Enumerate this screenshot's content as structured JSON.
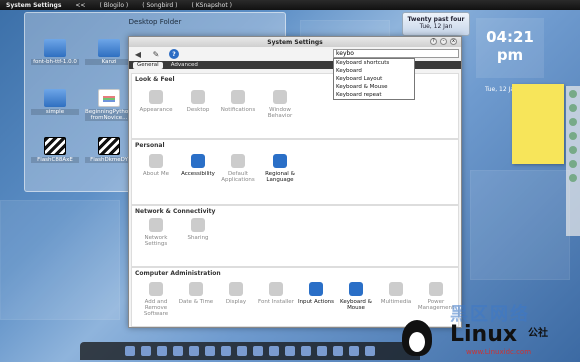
{
  "top_panel": {
    "app_title": "System Settings",
    "menu_marker": "<<",
    "tasks": [
      "( Blogilo )",
      "( Songbird )",
      "( KSnapshot )"
    ]
  },
  "desktop_folder": {
    "title": "Desktop Folder",
    "items": [
      {
        "label": "font-bh-ttf-1.0.0",
        "icon": "folder-icon"
      },
      {
        "label": "Kanzi",
        "icon": "folder-icon"
      },
      {
        "label": "simple",
        "icon": "folder-icon"
      },
      {
        "label": "BeginningPython-fromNovice...",
        "icon": "document-icon"
      },
      {
        "label": "FlashC88AxE",
        "icon": "clapperboard-icon"
      },
      {
        "label": "FlashDkmeDY",
        "icon": "clapperboard-icon"
      }
    ]
  },
  "clock_widget": {
    "title": "Twenty past four",
    "date": "Tue, 12 Jan"
  },
  "big_clock": {
    "time": "04:21 pm",
    "date": "Tue, 12 Jan 2010"
  },
  "window": {
    "title": "System Settings",
    "controls": [
      "?",
      "-",
      "x"
    ],
    "search_value": "keybo",
    "suggestions": [
      "Keyboard shortcuts",
      "Keyboard",
      "Keyboard Layout",
      "Keyboard & Mouse",
      "Keyboard repeat"
    ],
    "tabs": [
      "General",
      "Advanced"
    ],
    "sections": [
      {
        "title": "Look & Feel",
        "items": [
          {
            "label": "Appearance",
            "icon": "appearance-icon",
            "active": false
          },
          {
            "label": "Desktop",
            "icon": "desktop-icon",
            "active": false
          },
          {
            "label": "Notifications",
            "icon": "notifications-icon",
            "active": false
          },
          {
            "label": "Window Behavior",
            "icon": "window-behavior-icon",
            "active": false
          }
        ]
      },
      {
        "title": "Personal",
        "items": [
          {
            "label": "About Me",
            "icon": "about-me-icon",
            "active": false
          },
          {
            "label": "Accessibility",
            "icon": "accessibility-icon",
            "active": true
          },
          {
            "label": "Default Applications",
            "icon": "default-applications-icon",
            "active": false
          },
          {
            "label": "Regional & Language",
            "icon": "regional-language-icon",
            "active": true
          }
        ]
      },
      {
        "title": "Network & Connectivity",
        "items": [
          {
            "label": "Network Settings",
            "icon": "network-settings-icon",
            "active": false
          },
          {
            "label": "Sharing",
            "icon": "sharing-icon",
            "active": false
          }
        ]
      },
      {
        "title": "Computer Administration",
        "items": [
          {
            "label": "Add and Remove Software",
            "icon": "add-remove-software-icon",
            "active": false
          },
          {
            "label": "Date & Time",
            "icon": "date-time-icon",
            "active": false
          },
          {
            "label": "Display",
            "icon": "display-icon",
            "active": false
          },
          {
            "label": "Font Installer",
            "icon": "font-installer-icon",
            "active": false
          },
          {
            "label": "Input Actions",
            "icon": "input-actions-icon",
            "active": true
          },
          {
            "label": "Keyboard & Mouse",
            "icon": "keyboard-mouse-icon",
            "active": true
          },
          {
            "label": "Multimedia",
            "icon": "multimedia-icon",
            "active": false
          },
          {
            "label": "Power Management",
            "icon": "power-management-icon",
            "active": false
          }
        ]
      }
    ]
  },
  "watermark": {
    "chinese": "黑区网络",
    "brand": "Linux",
    "suffix": "公社",
    "url": "www.Linuxidc.com"
  },
  "colors": {
    "accent": "#2a6fc7",
    "sticky_note": "#f7e55a",
    "desktop": "#5d8fc6"
  }
}
